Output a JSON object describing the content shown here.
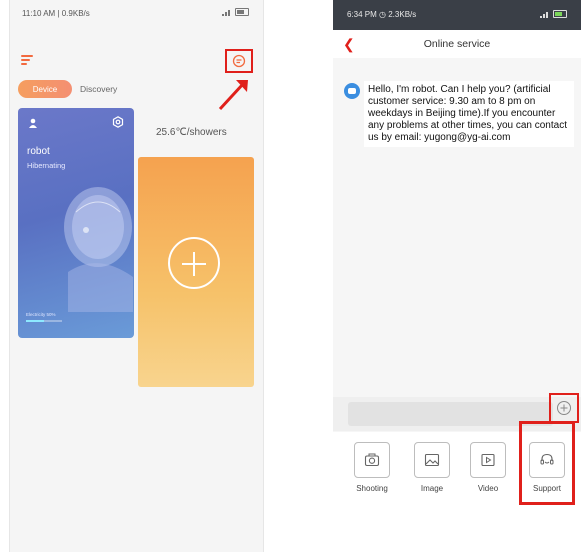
{
  "left": {
    "status_time": "11:10 AM | 0.9KB/s",
    "tabs": {
      "active": "Device",
      "other": "Discovery"
    },
    "device": {
      "name": "robot",
      "status": "Hibernating",
      "electricity_label": "Electricity 50%",
      "electricity_level": 0.5
    },
    "weather": "25.6℃/showers",
    "icons": [
      "menu-icon",
      "chat-icon",
      "user-icon",
      "gear-icon",
      "add-icon"
    ]
  },
  "right": {
    "status_time": "6:34 PM",
    "status_speed": "2.3KB/s",
    "title": "Online service",
    "message": "Hello, I'm robot. Can I help you? (artificial customer service: 9.30 am to 8 pm on weekdays in Beijing time).If you encounter any problems at other times, you can contact us by email: yugong@yg-ai.com",
    "tools": [
      {
        "label": "Shooting",
        "icon": "camera-icon"
      },
      {
        "label": "Image",
        "icon": "image-icon"
      },
      {
        "label": "Video",
        "icon": "video-icon"
      },
      {
        "label": "Support",
        "icon": "support-icon"
      }
    ]
  },
  "colors": {
    "accent": "#f26a3f",
    "highlight": "#e0201b",
    "device_card": "#5970c2",
    "add_card": "#f5a24f"
  }
}
